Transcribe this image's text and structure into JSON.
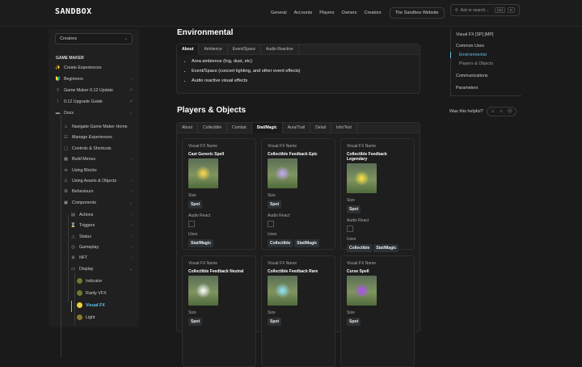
{
  "header": {
    "logo": "SANDBOX",
    "nav": [
      "General",
      "Accounts",
      "Players",
      "Owners",
      "Creators"
    ],
    "website": "The Sandbox Website",
    "search_placeholder": "Ask or search...",
    "kbd1": "Ctrl",
    "kbd2": "K"
  },
  "sidebar": {
    "select": "Creators",
    "section": "GAME MAKER",
    "items": [
      {
        "label": "Create Experiences",
        "icon": "✨"
      },
      {
        "label": "Beginners",
        "icon": "🔰"
      },
      {
        "label": "Game Maker 0.12 Update",
        "icon": "⇧"
      },
      {
        "label": "0.12 Upgrade Guide",
        "icon": "!"
      },
      {
        "label": "Docs",
        "icon": "▬"
      }
    ],
    "docs": [
      "Navigate Game Maker Home",
      "Manage Experiences",
      "Controls & Shortcuts",
      "Build Menus",
      "Using Blocks",
      "Using Assets & Objects",
      "Behaviours",
      "Components"
    ],
    "components": [
      "Actions",
      "Triggers",
      "Status",
      "Gameplay",
      "NFT",
      "Display"
    ],
    "display": [
      {
        "label": "Indicator",
        "color": "#6b7a2e"
      },
      {
        "label": "Rarity VFX",
        "color": "#6b7a2e"
      },
      {
        "label": "Visual FX",
        "color": "#f2d23a"
      },
      {
        "label": "Light",
        "color": "#8a7a2a"
      }
    ]
  },
  "environmental": {
    "title": "Environmental",
    "tabs": [
      "About",
      "Ambience",
      "Event/Space",
      "Audio Reactive"
    ],
    "bullets": [
      "Area ambience (fog, dust, etc)",
      "Event/Space (concert lighting, and other event effects)",
      "Audio reactive visual effects"
    ]
  },
  "players": {
    "title": "Players & Objects",
    "tabs": [
      "About",
      "Collectible",
      "Combat",
      "Stat/Magic",
      "Aura/Trail",
      "Detail",
      "Info/Text"
    ],
    "labels": {
      "name": "Visual FX Name",
      "size": "Size",
      "audio": "Audio React",
      "uses": "Uses"
    },
    "cards": [
      {
        "name": "Cast Generic Spell",
        "size": "Spot",
        "uses": [
          "Stat/Magic"
        ],
        "glow": "#ffd84a"
      },
      {
        "name": "Collectible Feedback Epic",
        "size": "Spot",
        "uses": [
          "Collectible",
          "Stat/Magic"
        ],
        "glow": "#c9a6ff"
      },
      {
        "name": "Collectible Feedback Legendary",
        "size": "Spot",
        "uses": [
          "Collectible",
          "Stat/Magic"
        ],
        "glow": "#ffe640"
      },
      {
        "name": "Collectible Feedback Neutral",
        "size": "Spot",
        "glow": "#ffffff"
      },
      {
        "name": "Collectible Feedback Rare",
        "size": "Spot",
        "glow": "#8fe6ff"
      },
      {
        "name": "Curse Spell",
        "size": "Spot",
        "glow": "#b04cff"
      }
    ]
  },
  "toc": {
    "items": [
      "Visual FX [SP] [MP]",
      "Common Uses",
      "Environmental",
      "Players & Objects",
      "Communications",
      "Parameters"
    ],
    "helpful": "Was this helpful?"
  }
}
